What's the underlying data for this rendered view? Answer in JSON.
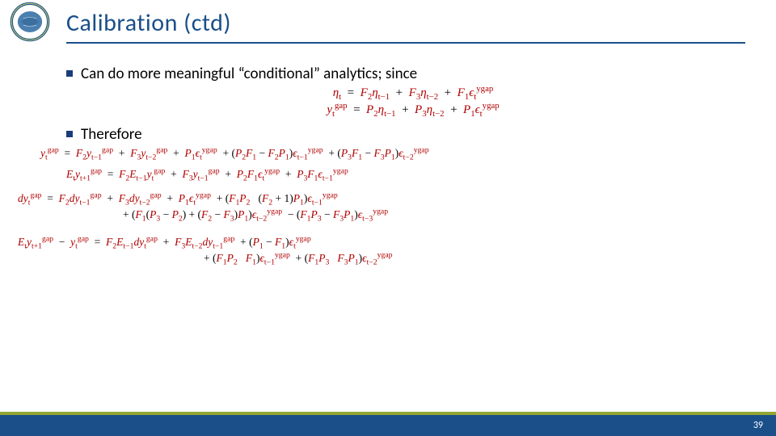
{
  "title": "Calibration (ctd)",
  "bullet1": " Can do more meaningful “conditional” analytics; since",
  "bullet2": "Therefore",
  "page_number": "39",
  "equations": {
    "since1_lhs": "η",
    "since1_lhs_sub": "t",
    "since2_lhs_var": "y",
    "since2_lhs_sup": "gap",
    "since2_lhs_sub": "t",
    "F2": "F",
    "F2n": "2",
    "F3": "F",
    "F3n": "3",
    "F1": "F",
    "F1n": "1",
    "P2": "P",
    "P2n": "2",
    "P3": "P",
    "P3n": "3",
    "P1": "P",
    "P1n": "1",
    "eta": "η",
    "eps": "ϵ",
    "y": "y",
    "E": "E",
    "d": "d",
    "gap": "gap",
    "ygap": "ygap",
    "t": "t",
    "tm1": "t−1",
    "tm2": "t−2",
    "tm3": "t−3",
    "tp1": "t+1"
  }
}
